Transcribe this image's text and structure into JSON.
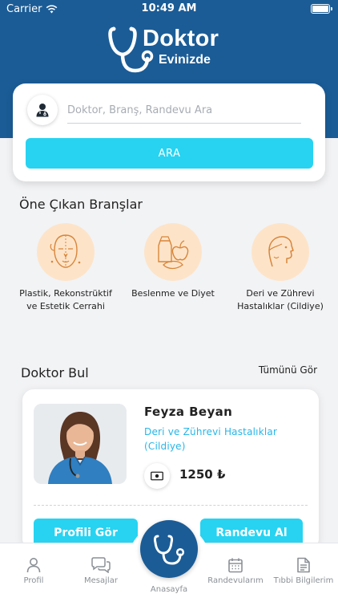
{
  "status_bar": {
    "carrier": "Carrier",
    "time": "10:49 AM"
  },
  "brand": {
    "title": "Doktor",
    "subtitle": "Evinizde"
  },
  "search": {
    "placeholder": "Doktor, Branş, Randevu Ara",
    "button_label": "ARA"
  },
  "featured": {
    "title": "Öne Çıkan Branşlar",
    "items": [
      {
        "label_line1": "Plastik, Rekonstrüktif",
        "label_line2": "ve Estetik Cerrahi",
        "icon": "face-surgery-icon"
      },
      {
        "label_line1": "Beslenme ve Diyet",
        "label_line2": "",
        "icon": "nutrition-icon"
      },
      {
        "label_line1": "Deri ve Zührevi",
        "label_line2": "Hastalıklar (Cildiye)",
        "icon": "skin-profile-icon"
      }
    ]
  },
  "doctor_section": {
    "title": "Doktor Bul",
    "see_all": "Tümünü Gör"
  },
  "doctor": {
    "name": "Feyza Beyan",
    "specialty": "Deri ve Zührevi Hastalıklar (Cildiye)",
    "price": "1250 ₺",
    "profile_button": "Profili Gör",
    "appointment_button": "Randevu Al"
  },
  "tabbar": {
    "profile": "Profil",
    "messages": "Mesajlar",
    "home": "Anasayfa",
    "appointments": "Randevularım",
    "medical_info": "Tıbbi Bilgilerim"
  },
  "colors": {
    "primary": "#1b5c96",
    "accent": "#27d3f1",
    "branch_circle": "#fde4c9",
    "link": "#27b6e8"
  }
}
